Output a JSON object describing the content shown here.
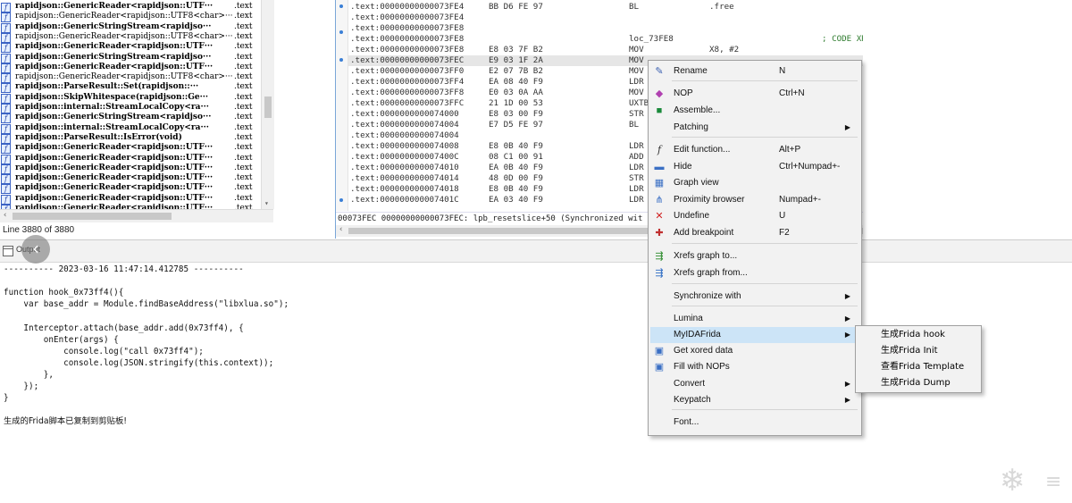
{
  "functions": {
    "rows": [
      {
        "name": "rapidjson::GenericReader<rapidjson::UTF···",
        "seg": ".text",
        "thin": false
      },
      {
        "name": "rapidjson::GenericReader<rapidjson::UTF8<char>···",
        "seg": ".text",
        "thin": true
      },
      {
        "name": "rapidjson::GenericStringStream<rapidjso···",
        "seg": ".text",
        "thin": false
      },
      {
        "name": "rapidjson::GenericReader<rapidjson::UTF8<char>···",
        "seg": ".text",
        "thin": true
      },
      {
        "name": "rapidjson::GenericReader<rapidjson::UTF···",
        "seg": ".text",
        "thin": false
      },
      {
        "name": "rapidjson::GenericStringStream<rapidjso···",
        "seg": ".text",
        "thin": false
      },
      {
        "name": "rapidjson::GenericReader<rapidjson::UTF···",
        "seg": ".text",
        "thin": false
      },
      {
        "name": "rapidjson::GenericReader<rapidjson::UTF8<char>···",
        "seg": ".text",
        "thin": true
      },
      {
        "name": "rapidjson::ParseResult::Set(rapidjson::···",
        "seg": ".text",
        "thin": false
      },
      {
        "name": "rapidjson::SkipWhitespace(rapidjson::Ge···",
        "seg": ".text",
        "thin": false
      },
      {
        "name": "rapidjson::internal::StreamLocalCopy<ra···",
        "seg": ".text",
        "thin": false
      },
      {
        "name": "rapidjson::GenericStringStream<rapidjso···",
        "seg": ".text",
        "thin": false
      },
      {
        "name": "rapidjson::internal::StreamLocalCopy<ra···",
        "seg": ".text",
        "thin": false
      },
      {
        "name": "rapidjson::ParseResult::IsError(void)",
        "seg": ".text",
        "thin": false
      },
      {
        "name": "rapidjson::GenericReader<rapidjson::UTF···",
        "seg": ".text",
        "thin": false
      },
      {
        "name": "rapidjson::GenericReader<rapidjson::UTF···",
        "seg": ".text",
        "thin": false
      },
      {
        "name": "rapidjson::GenericReader<rapidjson::UTF···",
        "seg": ".text",
        "thin": false
      },
      {
        "name": "rapidjson::GenericReader<rapidjson::UTF···",
        "seg": ".text",
        "thin": false
      },
      {
        "name": "rapidjson::GenericReader<rapidjson::UTF···",
        "seg": ".text",
        "thin": false
      },
      {
        "name": "rapidjson::GenericReader<rapidjson::UTF···",
        "seg": ".text",
        "thin": false
      },
      {
        "name": "rapidjson::GenericReader<rapidjson::UTF···",
        "seg": ".text",
        "thin": false
      }
    ],
    "status": "Line 3880 of 3880"
  },
  "disasm": {
    "lines": [
      {
        "addr": ".text:00000000000073FE4",
        "bytes": "BB D6 FE 97",
        "mnem": "BL",
        "ops": ".free",
        "cmt": "",
        "sel": false
      },
      {
        "addr": ".text:00000000000073FE4",
        "bytes": "",
        "mnem": "",
        "ops": "",
        "cmt": "",
        "sel": false
      },
      {
        "addr": ".text:00000000000073FE8",
        "bytes": "",
        "mnem": "",
        "ops": "",
        "cmt": "",
        "sel": false
      },
      {
        "addr": ".text:00000000000073FE8",
        "bytes": "",
        "mnem": "loc_73FE8",
        "ops": "",
        "cmt": "; CODE XREF: lpb_resetslice+38↑j",
        "sel": false
      },
      {
        "addr": ".text:00000000000073FE8",
        "bytes": "E8 03 7F B2",
        "mnem": "MOV",
        "ops": "X8, #2",
        "cmt": "",
        "sel": false
      },
      {
        "addr": ".text:00000000000073FEC",
        "bytes": "E9 03 1F 2A",
        "mnem": "MOV",
        "ops": "",
        "cmt": "",
        "sel": true
      },
      {
        "addr": ".text:00000000000073FF0",
        "bytes": "E2 07 7B B2",
        "mnem": "MOV",
        "ops": "",
        "cmt": "",
        "sel": false
      },
      {
        "addr": ".text:00000000000073FF4",
        "bytes": "EA 08 40 F9",
        "mnem": "LDR",
        "ops": "",
        "cmt": "",
        "sel": false
      },
      {
        "addr": ".text:00000000000073FF8",
        "bytes": "E0 03 0A AA",
        "mnem": "MOV",
        "ops": "",
        "cmt": "",
        "sel": false
      },
      {
        "addr": ".text:00000000000073FFC",
        "bytes": "21 1D 00 53",
        "mnem": "UXTB",
        "ops": "",
        "cmt": "",
        "sel": false
      },
      {
        "addr": ".text:0000000000074000",
        "bytes": "E8 03 00 F9",
        "mnem": "STR",
        "ops": "",
        "cmt": "",
        "sel": false
      },
      {
        "addr": ".text:0000000000074004",
        "bytes": "E7 D5 FE 97",
        "mnem": "BL",
        "ops": "",
        "cmt": "",
        "sel": false
      },
      {
        "addr": ".text:0000000000074004",
        "bytes": "",
        "mnem": "",
        "ops": "",
        "cmt": "",
        "sel": false
      },
      {
        "addr": ".text:0000000000074008",
        "bytes": "E8 0B 40 F9",
        "mnem": "LDR",
        "ops": "",
        "cmt": "",
        "sel": false
      },
      {
        "addr": ".text:000000000007400C",
        "bytes": "08 C1 00 91",
        "mnem": "ADD",
        "ops": "",
        "cmt": "",
        "sel": false
      },
      {
        "addr": ".text:0000000000074010",
        "bytes": "EA 0B 40 F9",
        "mnem": "LDR",
        "ops": "",
        "cmt": "",
        "sel": false
      },
      {
        "addr": ".text:0000000000074014",
        "bytes": "48 0D 00 F9",
        "mnem": "STR",
        "ops": "",
        "cmt": "",
        "sel": false
      },
      {
        "addr": ".text:0000000000074018",
        "bytes": "E8 0B 40 F9",
        "mnem": "LDR",
        "ops": "",
        "cmt": "",
        "sel": false
      },
      {
        "addr": ".text:000000000007401C",
        "bytes": "EA 03 40 F9",
        "mnem": "LDR",
        "ops": "",
        "cmt": "",
        "sel": false
      }
    ],
    "status": "00073FEC 00000000000073FEC: lpb_resetslice+50 (Synchronized wit"
  },
  "output": {
    "title": "Output",
    "lines": [
      "---------- 2023-03-16 11:47:14.412785 ----------",
      "",
      "function hook_0x73ff4(){",
      "    var base_addr = Module.findBaseAddress(\"libxlua.so\");",
      "",
      "    Interceptor.attach(base_addr.add(0x73ff4), {",
      "        onEnter(args) {",
      "            console.log(\"call 0x73ff4\");",
      "            console.log(JSON.stringify(this.context));",
      "        },",
      "    });",
      "}",
      "",
      "生成的Frida脚本已复制到剪贴板!"
    ]
  },
  "context_menu": {
    "items": [
      {
        "label": "Rename",
        "shortcut": "N",
        "icon": "rename-icon",
        "glyph": "✎",
        "color": "#3a5fb0",
        "sub": false
      },
      {
        "label": "NOP",
        "shortcut": "Ctrl+N",
        "icon": "nop-eraser-icon",
        "glyph": "◆",
        "color": "#b040b0",
        "sub": false
      },
      {
        "label": "Assemble...",
        "shortcut": "",
        "icon": "assemble-icon",
        "glyph": "■",
        "color": "#1a8a3a",
        "sub": false
      },
      {
        "label": "Patching",
        "shortcut": "",
        "icon": "",
        "glyph": "",
        "color": "",
        "sub": true
      },
      {
        "label": "Edit function...",
        "shortcut": "Alt+P",
        "icon": "function-icon",
        "glyph": "f",
        "color": "#333333",
        "sub": false
      },
      {
        "label": "Hide",
        "shortcut": "Ctrl+Numpad+-",
        "icon": "hide-icon",
        "glyph": "▬",
        "color": "#3a6fc4",
        "sub": false
      },
      {
        "label": "Graph view",
        "shortcut": "",
        "icon": "graph-view-icon",
        "glyph": "▦",
        "color": "#3a6fc4",
        "sub": false
      },
      {
        "label": "Proximity browser",
        "shortcut": "Numpad+-",
        "icon": "proximity-icon",
        "glyph": "⋔",
        "color": "#3a6fc4",
        "sub": false
      },
      {
        "label": "Undefine",
        "shortcut": "U",
        "icon": "undefine-x-icon",
        "glyph": "✕",
        "color": "#d02020",
        "sub": false
      },
      {
        "label": "Add breakpoint",
        "shortcut": "F2",
        "icon": "breakpoint-icon",
        "glyph": "✚",
        "color": "#c03030",
        "sub": false
      },
      {
        "label": "Xrefs graph to...",
        "shortcut": "",
        "icon": "xrefs-to-icon",
        "glyph": "⇶",
        "color": "#2a8a2a",
        "sub": false
      },
      {
        "label": "Xrefs graph from...",
        "shortcut": "",
        "icon": "xrefs-from-icon",
        "glyph": "⇶",
        "color": "#2a6ac4",
        "sub": false
      },
      {
        "label": "Synchronize with",
        "shortcut": "",
        "icon": "",
        "glyph": "",
        "color": "",
        "sub": true
      },
      {
        "label": "Lumina",
        "shortcut": "",
        "icon": "",
        "glyph": "",
        "color": "",
        "sub": true
      },
      {
        "label": "MyIDAFrida",
        "shortcut": "",
        "icon": "",
        "glyph": "",
        "color": "",
        "sub": true
      },
      {
        "label": "Get xored data",
        "shortcut": "",
        "icon": "plugin-icon",
        "glyph": "▣",
        "color": "#3a6fc4",
        "sub": false
      },
      {
        "label": "Fill with NOPs",
        "shortcut": "",
        "icon": "plugin-icon",
        "glyph": "▣",
        "color": "#3a6fc4",
        "sub": false
      },
      {
        "label": "Convert",
        "shortcut": "",
        "icon": "",
        "glyph": "",
        "color": "",
        "sub": true
      },
      {
        "label": "Keypatch",
        "shortcut": "",
        "icon": "",
        "glyph": "",
        "color": "",
        "sub": true
      },
      {
        "label": "Font...",
        "shortcut": "",
        "icon": "",
        "glyph": "",
        "color": "",
        "sub": false
      }
    ],
    "highlighted": "MyIDAFrida"
  },
  "submenu": {
    "items": [
      "生成Frida hook",
      "生成Frida Init",
      "查看Frida Template",
      "生成Frida Dump"
    ]
  },
  "colors": {
    "menu_highlight": "#cce4f7",
    "selection": "#e6e6e6",
    "comment": "#2f7c2f",
    "gutter_dot": "#3a7fd6"
  }
}
